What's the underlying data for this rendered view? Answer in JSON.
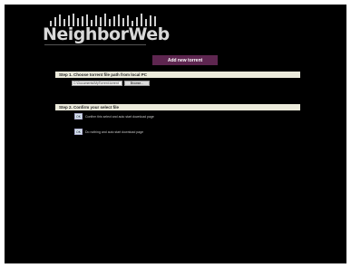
{
  "logo": {
    "text": "NeighborWeb"
  },
  "add_torrent": {
    "label": "Add new torrent"
  },
  "step1": {
    "header": "Step 1. Choose torrent file path from local PC",
    "file_value": "C:\\Documents\\MyTorrent.torrent",
    "browse_label": "Browse..."
  },
  "step2": {
    "header": "Step 2. Confirm your select file",
    "option1": {
      "button_label": "OK",
      "text": "Confirm this select and auto start download page"
    },
    "option2": {
      "button_label": "OK",
      "text": "Do nothing and auto start download page"
    }
  }
}
